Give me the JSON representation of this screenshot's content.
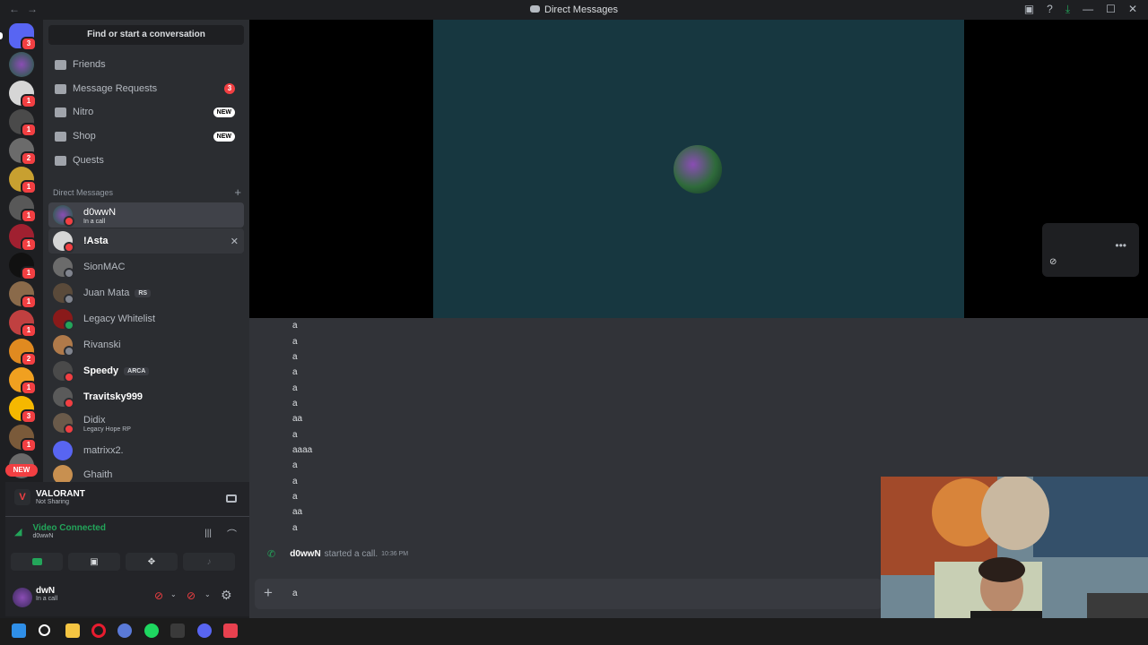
{
  "titlebar": {
    "back": "←",
    "forward": "→",
    "title": "Direct Messages",
    "icons": [
      "inbox-icon",
      "help-icon",
      "download-icon",
      "minimize-icon",
      "maximize-icon",
      "close-icon"
    ],
    "minimize": "—",
    "maximize": "☐",
    "close": "✕"
  },
  "servers": {
    "home_badge": "3",
    "badges": [
      "1",
      "1",
      "2",
      "1",
      "1",
      "1",
      "1",
      "1",
      "1",
      "2",
      "1",
      "3",
      "1"
    ],
    "new_label": "NEW"
  },
  "sidebar": {
    "search_label": "Find or start a conversation",
    "nav": [
      {
        "label": "Friends",
        "icon": "friends-icon"
      },
      {
        "label": "Message Requests",
        "icon": "mail-icon",
        "badge": "3"
      },
      {
        "label": "Nitro",
        "icon": "nitro-icon",
        "pill": "NEW"
      },
      {
        "label": "Shop",
        "icon": "shop-icon",
        "pill": "NEW"
      },
      {
        "label": "Quests",
        "icon": "quests-icon"
      }
    ],
    "dm_header": "Direct Messages",
    "dm_add": "+",
    "dms": [
      {
        "name": "d0wwN",
        "sub": "In a call"
      },
      {
        "name": "!Asta"
      },
      {
        "name": "SionMAC"
      },
      {
        "name": "Juan Mata",
        "tag": "RS"
      },
      {
        "name": "Legacy Whitelist"
      },
      {
        "name": "Rivanski"
      },
      {
        "name": "Speedy",
        "tag": "ARCA"
      },
      {
        "name": "Travitsky999"
      },
      {
        "name": "Didix",
        "sub": "Legacy Hope RP"
      },
      {
        "name": "matrixx2."
      },
      {
        "name": "Ghaith"
      }
    ]
  },
  "voice": {
    "game_name": "VALORANT",
    "game_status": "Not Sharing",
    "connection": "Video Connected",
    "channel": "d0wwN"
  },
  "user": {
    "name": "dwN",
    "status": "In a call"
  },
  "chat": {
    "messages": [
      "a",
      "a",
      "a",
      "a",
      "a",
      "a",
      "aa",
      "a",
      "aaaa",
      "a",
      "a",
      "a",
      "aa",
      "a"
    ],
    "call_user": "d0wwN",
    "call_text": "started a call.",
    "call_time": "10:36 PM",
    "composer_value": "a"
  },
  "colors": {
    "accent": "#5865f2",
    "green": "#23a55a",
    "red": "#f23f42",
    "tile_bg": "#173740"
  }
}
